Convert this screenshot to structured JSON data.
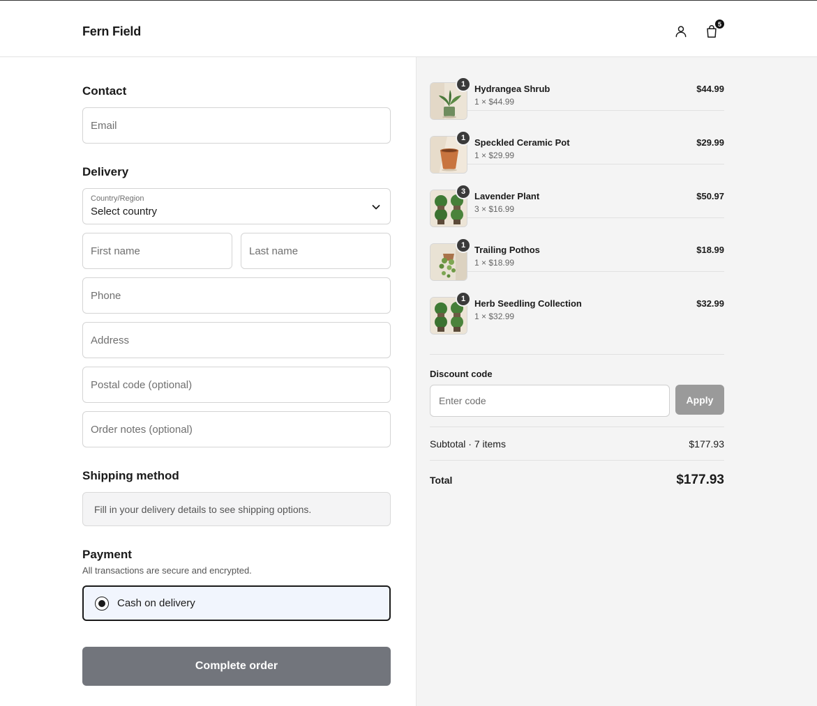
{
  "header": {
    "brand": "Fern Field",
    "cart_count": "5"
  },
  "contact": {
    "title": "Contact",
    "email_placeholder": "Email"
  },
  "delivery": {
    "title": "Delivery",
    "country_label": "Country/Region",
    "country_value": "Select country",
    "first_name_placeholder": "First name",
    "last_name_placeholder": "Last name",
    "phone_placeholder": "Phone",
    "address_placeholder": "Address",
    "postal_placeholder": "Postal code (optional)",
    "notes_placeholder": "Order notes (optional)"
  },
  "shipping": {
    "title": "Shipping method",
    "message": "Fill in your delivery details to see shipping options."
  },
  "payment": {
    "title": "Payment",
    "subtitle": "All transactions are secure and encrypted.",
    "option": "Cash on delivery"
  },
  "complete_label": "Complete order",
  "items": [
    {
      "name": "Hydrangea Shrub",
      "qty": "1",
      "unit": "1 × $44.99",
      "price": "$44.99"
    },
    {
      "name": "Speckled Ceramic Pot",
      "qty": "1",
      "unit": "1 × $29.99",
      "price": "$29.99"
    },
    {
      "name": "Lavender Plant",
      "qty": "3",
      "unit": "3 × $16.99",
      "price": "$50.97"
    },
    {
      "name": "Trailing Pothos",
      "qty": "1",
      "unit": "1 × $18.99",
      "price": "$18.99"
    },
    {
      "name": "Herb Seedling Collection",
      "qty": "1",
      "unit": "1 × $32.99",
      "price": "$32.99"
    }
  ],
  "discount": {
    "label": "Discount code",
    "placeholder": "Enter code",
    "apply": "Apply"
  },
  "summary": {
    "subtotal_label": "Subtotal · 7 items",
    "subtotal_value": "$177.93",
    "total_label": "Total",
    "total_value": "$177.93"
  },
  "colors": {
    "primary_button": "#72757c",
    "apply_button": "#9a9a9a",
    "selected_payment_bg": "#f1f5fd",
    "summary_bg": "#f4f4f4"
  }
}
